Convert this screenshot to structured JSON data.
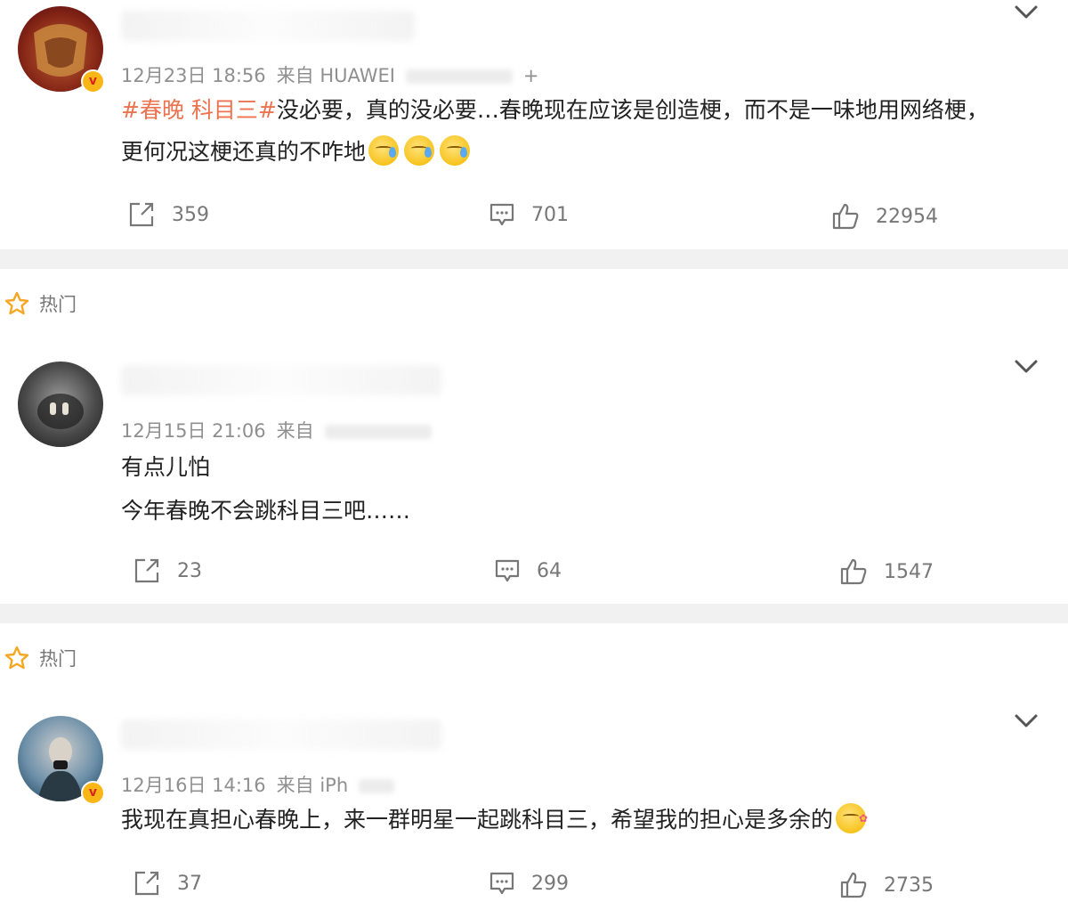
{
  "posts": [
    {
      "time": "12月23日 18:56",
      "source": "来自 HUAWEI",
      "source_tail": "+",
      "verified": true,
      "topic": "#春晚 科目三#",
      "text_lines": [
        "没必要，真的没必要…春晚现在应该是创造梗，而不是一味地用网络梗，",
        "更何况这梗还真的不咋地"
      ],
      "emoji_count": 3,
      "emoji_name": "sweat-face-icon",
      "shares": "359",
      "comments": "701",
      "likes": "22954"
    },
    {
      "hot_label": "热门",
      "time": "12月15日 21:06",
      "source": "来自",
      "verified": false,
      "text_lines": [
        "有点儿怕",
        "今年春晚不会跳科目三吧……"
      ],
      "shares": "23",
      "comments": "64",
      "likes": "1547"
    },
    {
      "hot_label": "热门",
      "time": "12月16日 14:16",
      "source": "来自 iPh",
      "verified": true,
      "text_lines": [
        "我现在真担心春晚上，来一群明星一起跳科目三，希望我的担心是多余的"
      ],
      "emoji_name": "wink-face-icon",
      "shares": "37",
      "comments": "299",
      "likes": "2735"
    }
  ],
  "colors": {
    "topic": "#eb7350",
    "meta": "#8f8f8f",
    "action": "#777777",
    "separator": "#f1f1f1",
    "hot_star": "#f5a623",
    "verified_badge": "#f8b617"
  }
}
